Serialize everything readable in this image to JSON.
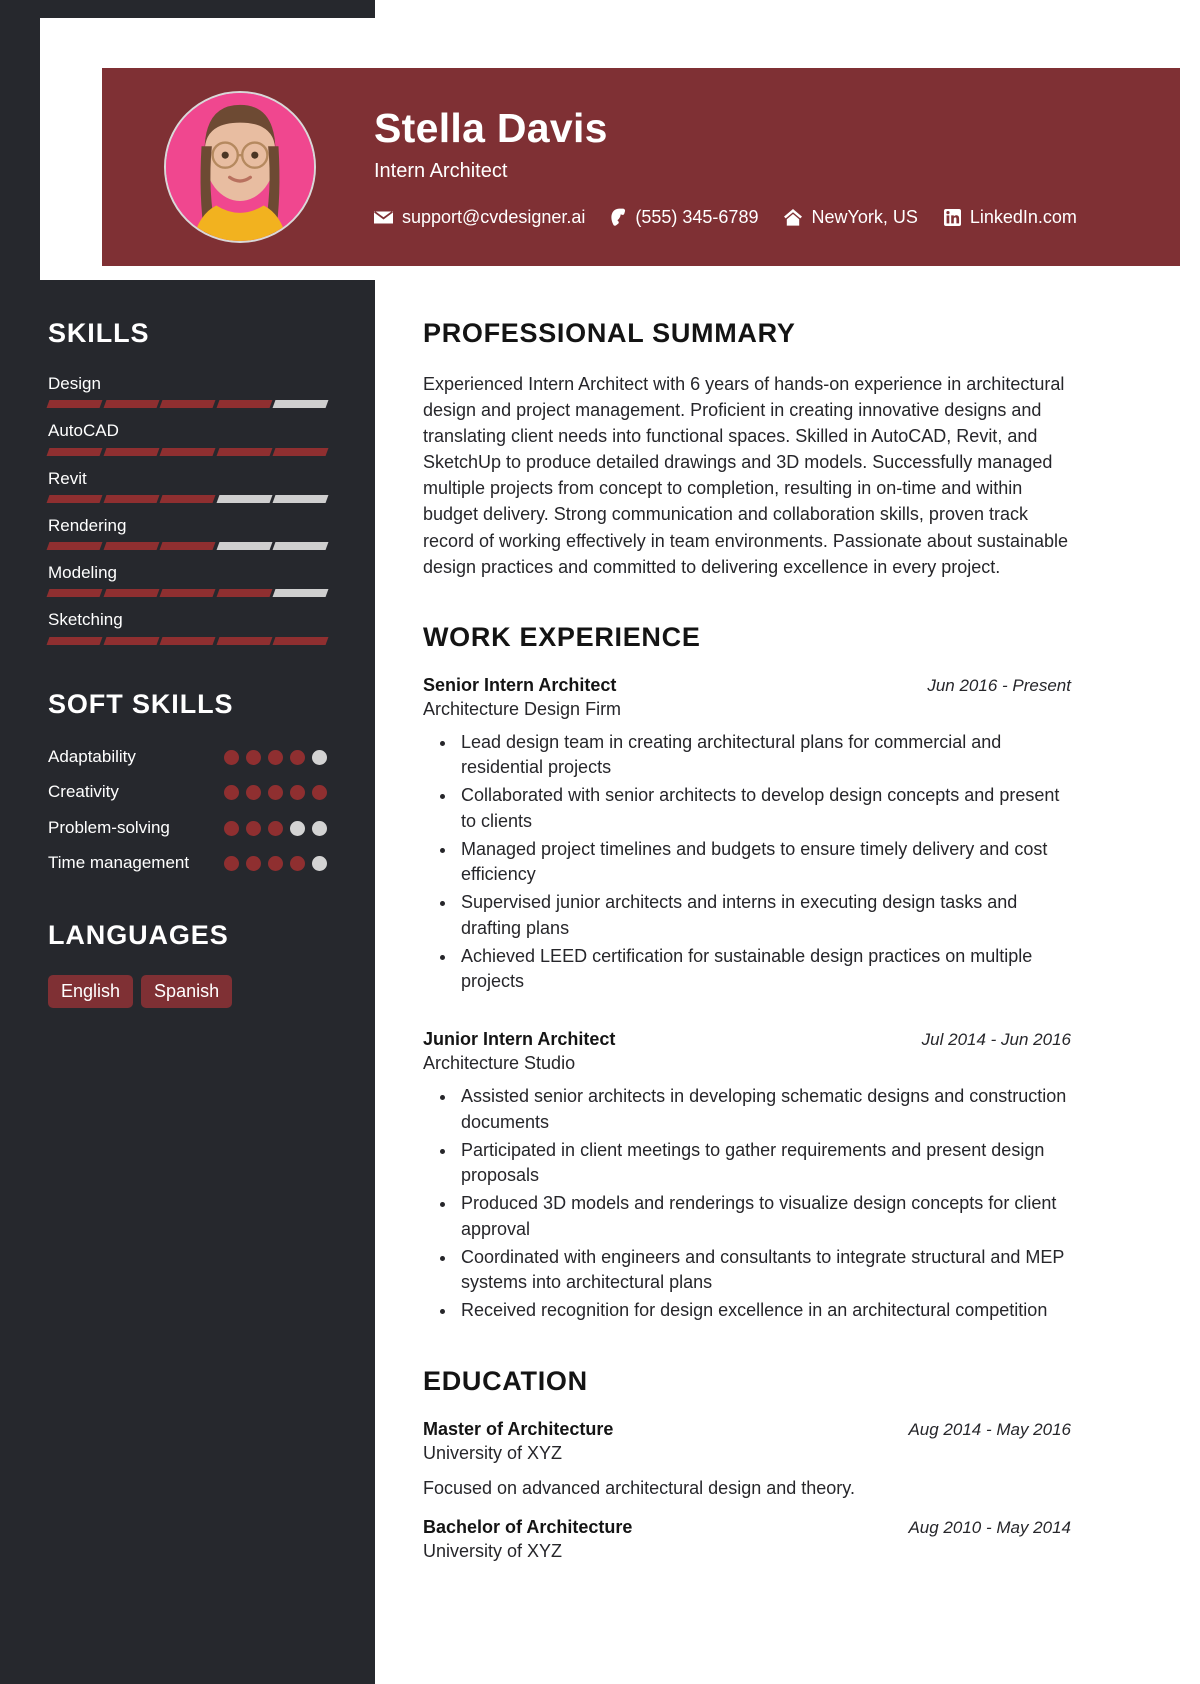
{
  "theme": {
    "accent": "#7f3034",
    "accent_bar": "#8f2f30",
    "sidebar_bg": "#26282d",
    "inactive": "#d3d3d3",
    "page_bg": "#ffffff",
    "avatar_bg": "#f0478f"
  },
  "header": {
    "name": "Stella Davis",
    "title": "Intern Architect",
    "contacts": [
      {
        "icon": "envelope-icon",
        "text": "support@cvdesigner.ai"
      },
      {
        "icon": "phone-icon",
        "text": "(555) 345-6789"
      },
      {
        "icon": "home-icon",
        "text": "NewYork, US"
      },
      {
        "icon": "linkedin-icon",
        "text": "LinkedIn.com"
      }
    ]
  },
  "sidebar": {
    "skills_heading": "SKILLS",
    "skills": [
      {
        "name": "Design",
        "level": 4,
        "max": 5
      },
      {
        "name": "AutoCAD",
        "level": 5,
        "max": 5
      },
      {
        "name": "Revit",
        "level": 3,
        "max": 5
      },
      {
        "name": "Rendering",
        "level": 3,
        "max": 5
      },
      {
        "name": "Modeling",
        "level": 4,
        "max": 5
      },
      {
        "name": "Sketching",
        "level": 5,
        "max": 5
      }
    ],
    "soft_skills_heading": "SOFT SKILLS",
    "soft_skills": [
      {
        "name": "Adaptability",
        "level": 4,
        "max": 5
      },
      {
        "name": "Creativity",
        "level": 5,
        "max": 5
      },
      {
        "name": "Problem-solving",
        "level": 3,
        "max": 5
      },
      {
        "name": "Time management",
        "level": 4,
        "max": 5
      }
    ],
    "languages_heading": "LANGUAGES",
    "languages": [
      "English",
      "Spanish"
    ]
  },
  "main": {
    "summary_heading": "PROFESSIONAL SUMMARY",
    "summary_text": "Experienced Intern Architect with 6 years of hands-on experience in architectural design and project management. Proficient in creating innovative designs and translating client needs into functional spaces. Skilled in AutoCAD, Revit, and SketchUp to produce detailed drawings and 3D models. Successfully managed multiple projects from concept to completion, resulting in on-time and within budget delivery. Strong communication and collaboration skills, proven track record of working effectively in team environments. Passionate about sustainable design practices and committed to delivering excellence in every project.",
    "work_heading": "WORK EXPERIENCE",
    "work": [
      {
        "title": "Senior Intern Architect",
        "date": "Jun 2016 - Present",
        "org": "Architecture Design Firm",
        "bullets": [
          "Lead design team in creating architectural plans for commercial and residential projects",
          "Collaborated with senior architects to develop design concepts and present to clients",
          "Managed project timelines and budgets to ensure timely delivery and cost efficiency",
          "Supervised junior architects and interns in executing design tasks and drafting plans",
          "Achieved LEED certification for sustainable design practices on multiple projects"
        ]
      },
      {
        "title": "Junior Intern Architect",
        "date": "Jul 2014 - Jun 2016",
        "org": "Architecture Studio",
        "bullets": [
          "Assisted senior architects in developing schematic designs and construction documents",
          "Participated in client meetings to gather requirements and present design proposals",
          "Produced 3D models and renderings to visualize design concepts for client approval",
          "Coordinated with engineers and consultants to integrate structural and MEP systems into architectural plans",
          "Received recognition for design excellence in an architectural competition"
        ]
      }
    ],
    "education_heading": "EDUCATION",
    "education": [
      {
        "degree": "Master of Architecture",
        "date": "Aug 2014 - May 2016",
        "school": "University of XYZ",
        "description": "Focused on advanced architectural design and theory."
      },
      {
        "degree": "Bachelor of Architecture",
        "date": "Aug 2010 - May 2014",
        "school": "University of XYZ",
        "description": ""
      }
    ]
  }
}
